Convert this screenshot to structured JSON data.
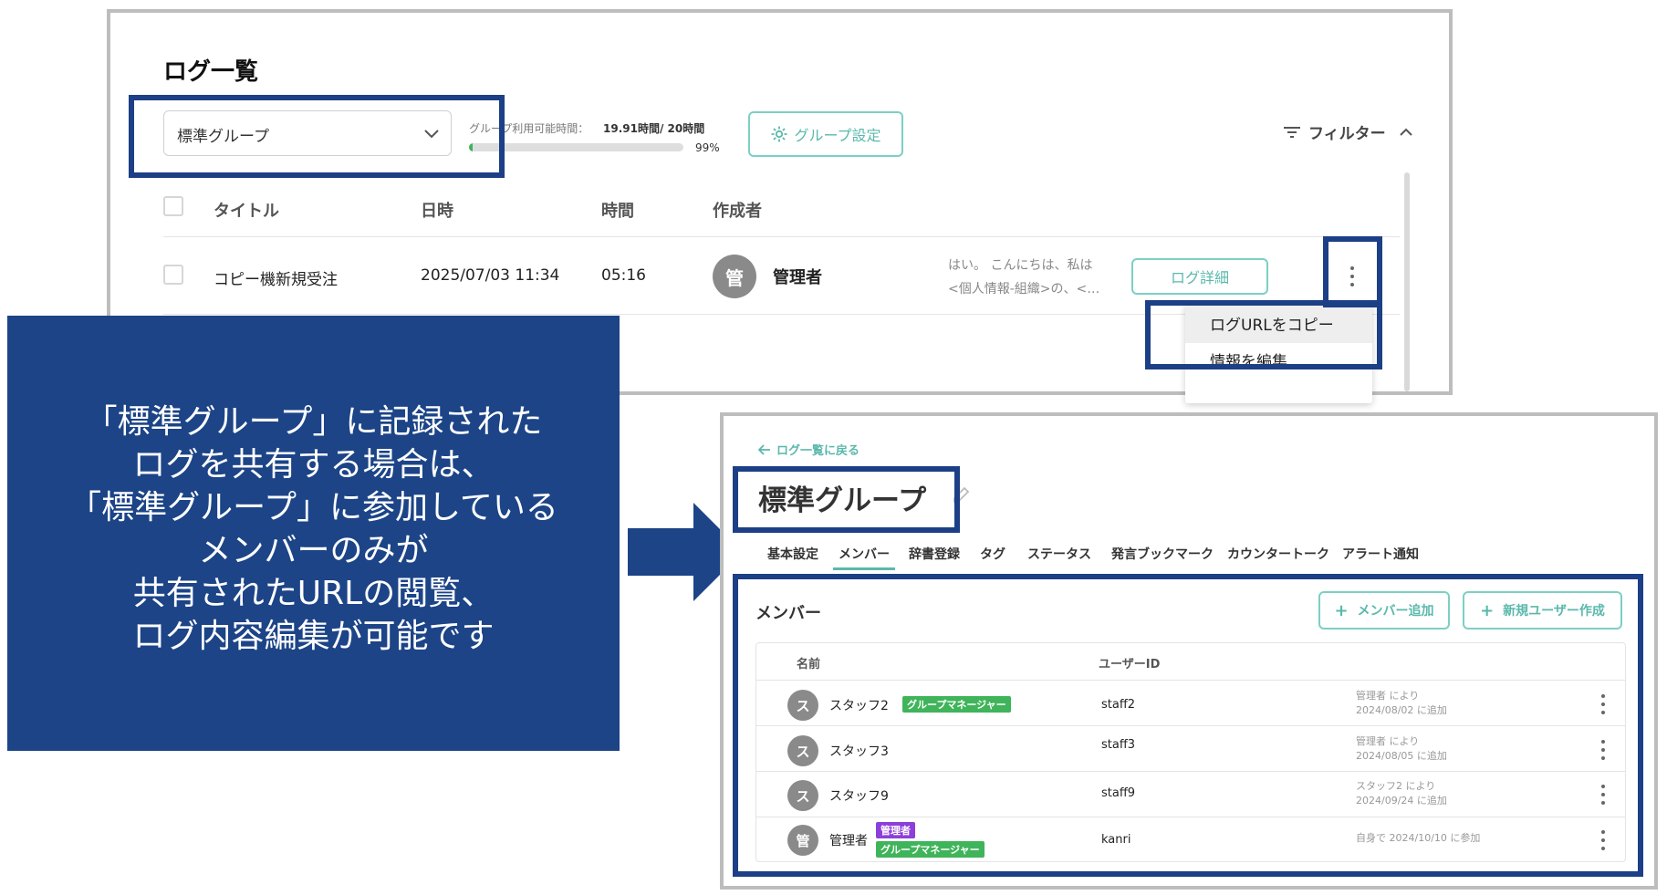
{
  "screen1": {
    "title": "ログ一覧",
    "group_select": {
      "value": "標準グループ"
    },
    "usage": {
      "label": "グループ利用可能時間：",
      "value": "19.91時間/ 20時間",
      "percent_label": "99%",
      "percent": 0.99
    },
    "group_settings_button": "グループ設定",
    "filter_label": "フィルター",
    "table": {
      "columns": [
        "タイトル",
        "日時",
        "時間",
        "作成者"
      ],
      "row": {
        "title": "コピー機新規受注",
        "datetime": "2025/07/03 11:34",
        "duration": "05:16",
        "author_avatar": "管",
        "author": "管理者",
        "preview_line1": "はい。 こんにちは、私は",
        "preview_line2": "<個人情報-組織>の、<…",
        "detail_button": "ログ詳細"
      }
    },
    "menu": {
      "items": [
        "ログURLをコピー",
        "情報を編集"
      ]
    }
  },
  "callout": {
    "lines": [
      "「標準グループ」に記録された",
      "ログを共有する場合は、",
      "「標準グループ」に参加している",
      "メンバーのみが",
      "共有されたURLの閲覧、",
      "ログ内容編集が可能です"
    ]
  },
  "screen2": {
    "back_link": "ログ一覧に戻る",
    "group_title": "標準グループ",
    "tabs": [
      "基本設定",
      "メンバー",
      "辞書登録",
      "タグ",
      "ステータス",
      "発言ブックマーク",
      "カウンタートーク",
      "アラート通知"
    ],
    "active_tab": "メンバー",
    "section_title": "メンバー",
    "add_member_button": "メンバー追加",
    "new_user_button": "新規ユーザー作成",
    "plus": "+",
    "columns": [
      "名前",
      "ユーザーID"
    ],
    "members": [
      {
        "avatar": "ス",
        "name": "スタッフ2",
        "tags": [
          "グループマネージャー"
        ],
        "user_id": "staff2",
        "note1": "管理者 により",
        "note2": "2024/08/02 に追加"
      },
      {
        "avatar": "ス",
        "name": "スタッフ3",
        "tags": [],
        "user_id": "staff3",
        "note1": "管理者 により",
        "note2": "2024/08/05 に追加"
      },
      {
        "avatar": "ス",
        "name": "スタッフ9",
        "tags": [],
        "user_id": "staff9",
        "note1": "スタッフ2 により",
        "note2": "2024/09/24 に追加"
      },
      {
        "avatar": "管",
        "name": "管理者",
        "tags": [
          "管理者",
          "グループマネージャー"
        ],
        "user_id": "kanri",
        "note1": "自身で 2024/10/10 に参加",
        "note2": ""
      }
    ]
  },
  "colors": {
    "highlight": "#1c3f86",
    "callout_bg": "#1c4487",
    "teal": "#5ab8ac",
    "green_tag": "#3fb45a",
    "purple_tag": "#8c3fd9"
  }
}
